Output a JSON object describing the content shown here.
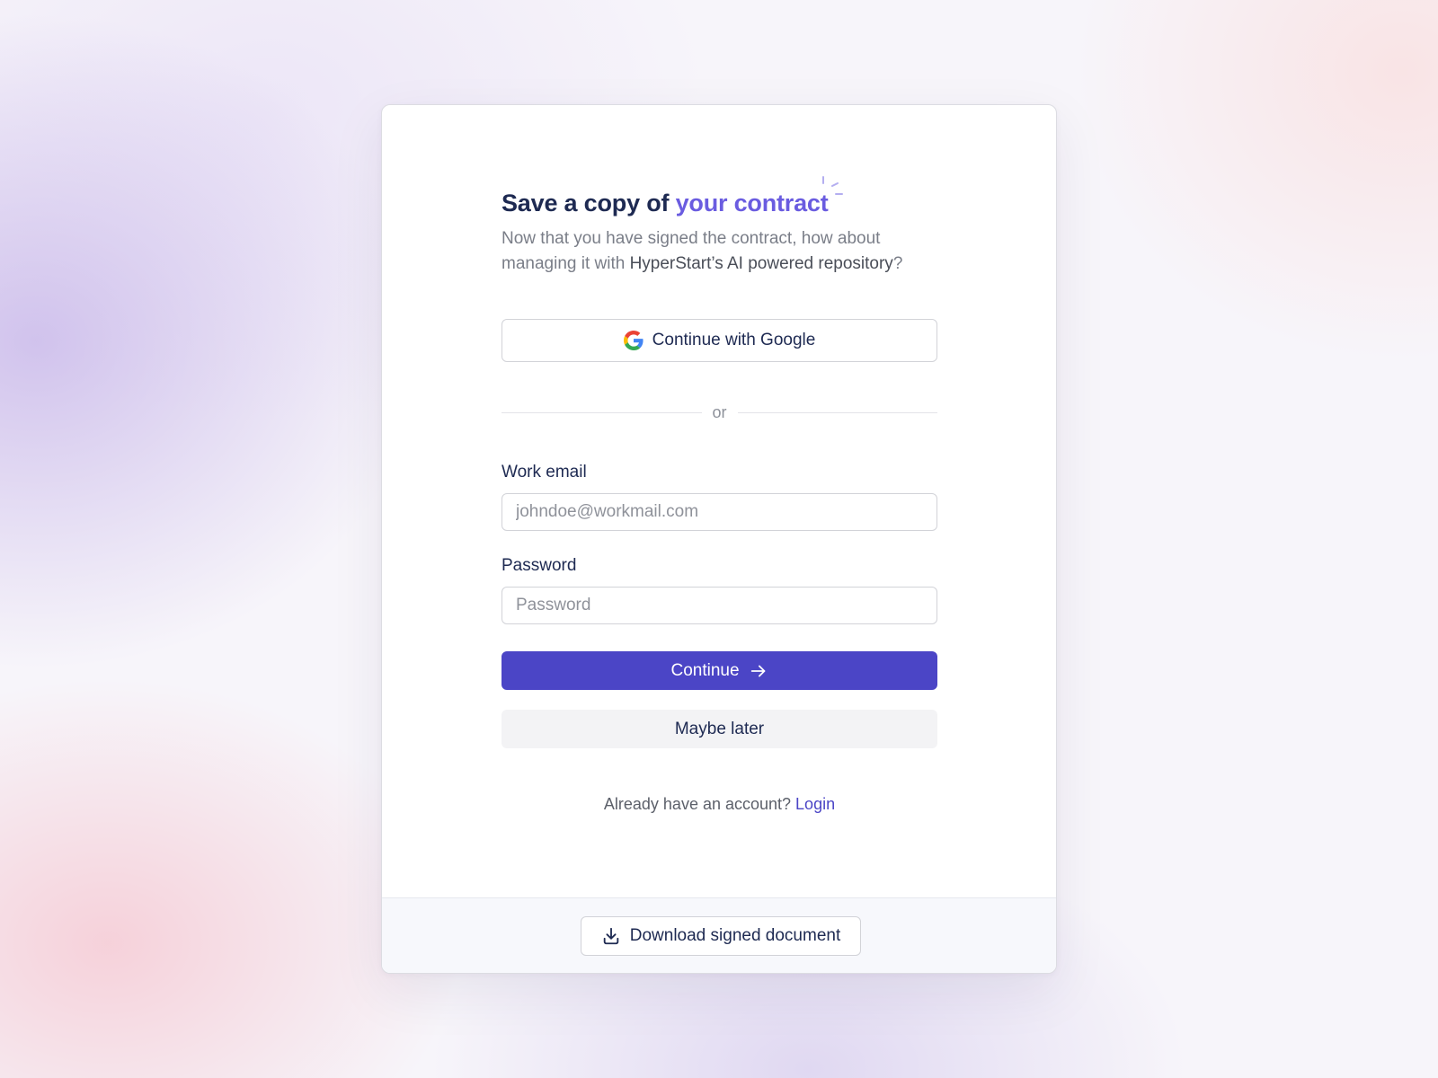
{
  "heading": {
    "prefix": "Save a copy of ",
    "accent": "your contract"
  },
  "subtitle": {
    "part1": "Now that you have signed the contract, how about managing it with ",
    "highlight": "HyperStart’s AI powered repository",
    "part2": "?"
  },
  "google_button": {
    "label": "Continue with Google",
    "icon": "google-icon"
  },
  "divider": {
    "text": "or"
  },
  "email": {
    "label": "Work email",
    "placeholder": "johndoe@workmail.com",
    "value": ""
  },
  "password": {
    "label": "Password",
    "placeholder": "Password",
    "value": ""
  },
  "continue_button": {
    "label": "Continue",
    "icon": "arrow-right-icon"
  },
  "later_button": {
    "label": "Maybe later"
  },
  "account": {
    "prompt": "Already have an account? ",
    "link": "Login"
  },
  "footer": {
    "download_label": "Download signed document",
    "icon": "download-icon"
  },
  "colors": {
    "primary": "#4b45c6",
    "accent_text": "#6a5ce0",
    "heading": "#1e2a52"
  }
}
